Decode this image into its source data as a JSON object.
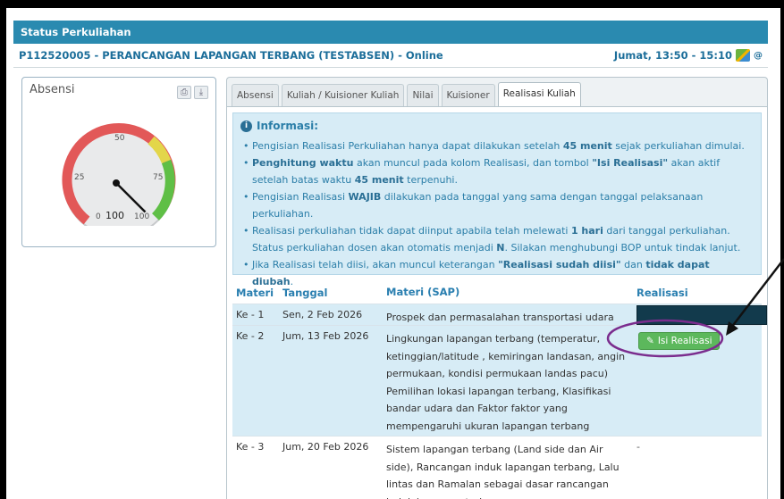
{
  "header": {
    "title": "Status Perkuliahan"
  },
  "course": {
    "code_name": "P112520005 - PERANCANGAN LAPANGAN TERBANG (TESTABSEN) - Online",
    "schedule": "Jumat, 13:50 - 15:10"
  },
  "absensi": {
    "title": "Absensi",
    "gauge": {
      "ticks": [
        "0",
        "25",
        "50",
        "75",
        "100"
      ],
      "value_label": "100",
      "value": 100,
      "max": 100
    },
    "print_icon": "print-icon",
    "download_icon": "download-icon"
  },
  "tabs": [
    "Absensi",
    "Kuliah / Kuisioner Kuliah",
    "Nilai",
    "Kuisioner",
    "Realisasi Kuliah"
  ],
  "active_tab": "Realisasi Kuliah",
  "info": {
    "heading": "Informasi:",
    "items": [
      [
        "Pengisian Realisasi Perkuliahan hanya dapat dilakukan setelah ",
        "45 menit",
        " sejak perkuliahan dimulai."
      ],
      [
        "",
        "Penghitung waktu",
        " akan muncul pada kolom Realisasi, dan tombol ",
        "\"Isi Realisasi\"",
        " akan aktif setelah batas waktu ",
        "45 menit",
        " terpenuhi."
      ],
      [
        "Pengisian Realisasi ",
        "WAJIB",
        " dilakukan pada tanggal yang sama dengan tanggal pelaksanaan perkuliahan."
      ],
      [
        "Realisasi perkuliahan tidak dapat diinput apabila telah melewati ",
        "1 hari",
        " dari tanggal perkuliahan. Status perkuliahan dosen akan otomatis menjadi ",
        "N",
        ". Silakan menghubungi BOP untuk tindak lanjut."
      ],
      [
        "Jika Realisasi telah diisi, akan muncul keterangan ",
        "\"Realisasi sudah diisi\"",
        " dan ",
        "tidak dapat diubah",
        "."
      ]
    ]
  },
  "table": {
    "headers": {
      "materi": "Materi",
      "tanggal": "Tanggal",
      "sap": "Materi (SAP)",
      "realisasi": "Realisasi"
    },
    "rows": [
      {
        "materi": "Ke - 1",
        "tanggal": "Sen, 2 Feb 2026",
        "sap": "Prospek dan permasalahan transportasi udara",
        "realisasi": ""
      },
      {
        "materi": "Ke - 2",
        "tanggal": "Jum, 13 Feb 2026",
        "sap": "Lingkungan lapangan terbang (temperatur, ketinggian/latitude , kemiringan landasan, angin permukaan, kondisi permukaan landas pacu) Pemilihan lokasi lapangan terbang, Klasifikasi bandar udara dan Faktor faktor yang mempengaruhi ukuran lapangan terbang",
        "realisasi": "Isi Realisasi"
      },
      {
        "materi": "Ke - 3",
        "tanggal": "Jum, 20 Feb 2026",
        "sap": "Sistem lapangan terbang (Land side dan Air side), Rancangan induk lapangan terbang, Lalu lintas dan Ramalan sebagai dasar rancangan induk lapangan terbang",
        "realisasi": "-"
      }
    ]
  },
  "colors": {
    "header_bar": "#2a8ab0",
    "info_bg": "#d7ecf6",
    "button_green": "#5cb85c",
    "annotation": "#7b2d8e",
    "bar_dark": "#123a4c"
  }
}
